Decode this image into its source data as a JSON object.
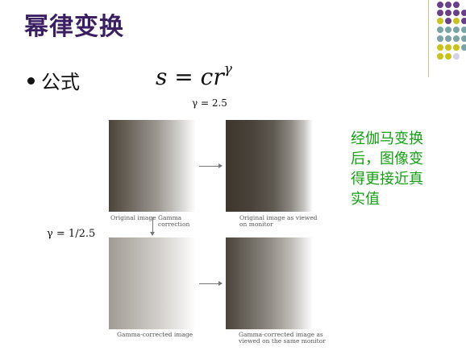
{
  "slide": {
    "title": "幂律变换",
    "bullet_label": "公式",
    "formula_base": "s = cr",
    "formula_exponent": "γ",
    "gamma_top": "γ = 2.5",
    "gamma_left": "γ = 1/2.5",
    "note": "经伽马变换后，图像变得更接近真实值"
  },
  "figure": {
    "caption_original": "Original image",
    "caption_gamma_correction_1": "Gamma",
    "caption_gamma_correction_2": "correction",
    "caption_monitor_1": "Original image as viewed",
    "caption_monitor_2": "on monitor",
    "caption_corrected": "Gamma-corrected image",
    "caption_corrected_monitor_1": "Gamma-corrected image as",
    "caption_corrected_monitor_2": "viewed on the same monitor"
  },
  "colors": {
    "title": "#3b1f63",
    "note": "#12a012",
    "dot_purple": "#6a3f8a",
    "dot_yellow": "#c9c21a",
    "dot_teal": "#7aa3a6",
    "dot_light": "#d5d0e6"
  }
}
